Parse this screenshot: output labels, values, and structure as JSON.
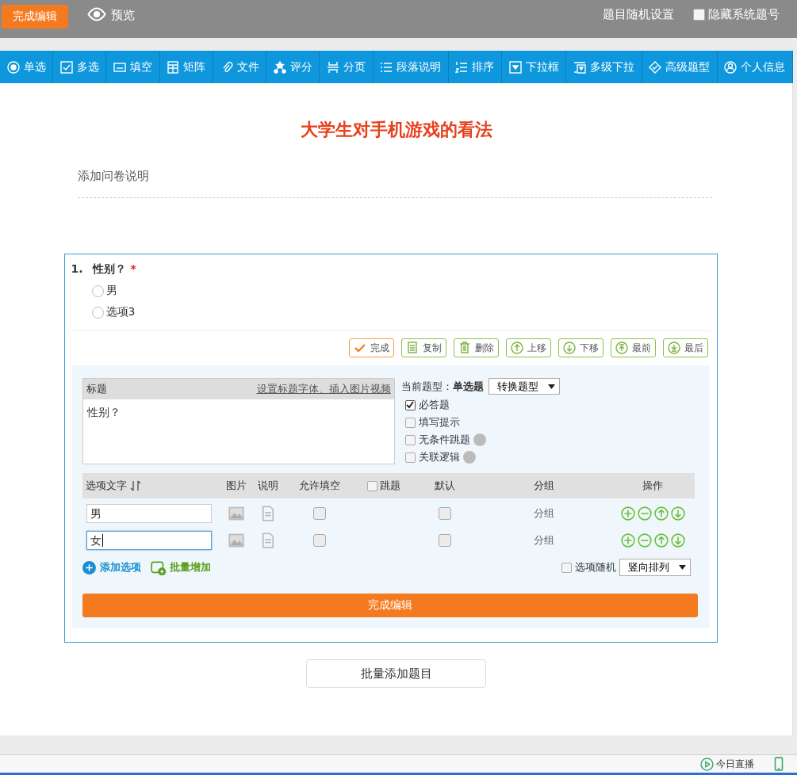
{
  "top_bar": {
    "finish_button": "完成编辑",
    "preview": "预览",
    "random_settings": "题目随机设置",
    "hide_numbers": {
      "label": "隐藏系统题号",
      "checked": false
    }
  },
  "toolbar": [
    {
      "label": "单选"
    },
    {
      "label": "多选"
    },
    {
      "label": "填空"
    },
    {
      "label": "矩阵"
    },
    {
      "label": "文件"
    },
    {
      "label": "评分"
    },
    {
      "label": "分页"
    },
    {
      "label": "段落说明"
    },
    {
      "label": "排序"
    },
    {
      "label": "下拉框"
    },
    {
      "label": "多级下拉"
    },
    {
      "label": "高级题型"
    },
    {
      "label": "个人信息"
    }
  ],
  "survey": {
    "title": "大学生对手机游戏的看法",
    "description": "添加问卷说明"
  },
  "question": {
    "number": "1.",
    "title": "性别？",
    "required": true,
    "required_mark": "*",
    "options": [
      {
        "label": "男",
        "selected": false
      },
      {
        "label": "选项3",
        "selected": false
      }
    ],
    "actions": [
      {
        "label": "完成",
        "kind": "primary"
      },
      {
        "label": "复制",
        "kind": "normal"
      },
      {
        "label": "删除",
        "kind": "normal"
      },
      {
        "label": "上移",
        "kind": "normal"
      },
      {
        "label": "下移",
        "kind": "normal"
      },
      {
        "label": "最前",
        "kind": "normal"
      },
      {
        "label": "最后",
        "kind": "normal"
      }
    ],
    "editor": {
      "title_label": "标题",
      "title_link": "设置标题字体、插入图片视频",
      "title_value": "性别？",
      "type_label": "当前题型：",
      "type_value": "单选题",
      "convert_select": "转换题型",
      "settings": [
        {
          "label": "必答题",
          "checked": true,
          "help": false
        },
        {
          "label": "填写提示",
          "checked": false,
          "help": false
        },
        {
          "label": "无条件跳题",
          "checked": false,
          "help": true
        },
        {
          "label": "关联逻辑",
          "checked": false,
          "help": true
        }
      ],
      "columns": [
        {
          "label": "选项文字"
        },
        {
          "label": "图片"
        },
        {
          "label": "说明"
        },
        {
          "label": "允许填空"
        },
        {
          "label": "跳题",
          "checked": false
        },
        {
          "label": "默认"
        },
        {
          "label": "分组"
        },
        {
          "label": "操作"
        }
      ],
      "rows": [
        {
          "value": "男",
          "focused": false,
          "fill_allowed": false,
          "default": false,
          "group": "分组"
        },
        {
          "value": "女",
          "focused": true,
          "fill_allowed": false,
          "default": false,
          "group": "分组"
        }
      ],
      "add_option": "添加选项",
      "batch_add": "批量增加",
      "random": {
        "label": "选项随机",
        "checked": false
      },
      "layout_select": "竖向排列",
      "finish_button": "完成编辑"
    }
  },
  "batch_add_questions": "批量添加题目",
  "status_bar": [
    {
      "label": "今日直播"
    }
  ]
}
